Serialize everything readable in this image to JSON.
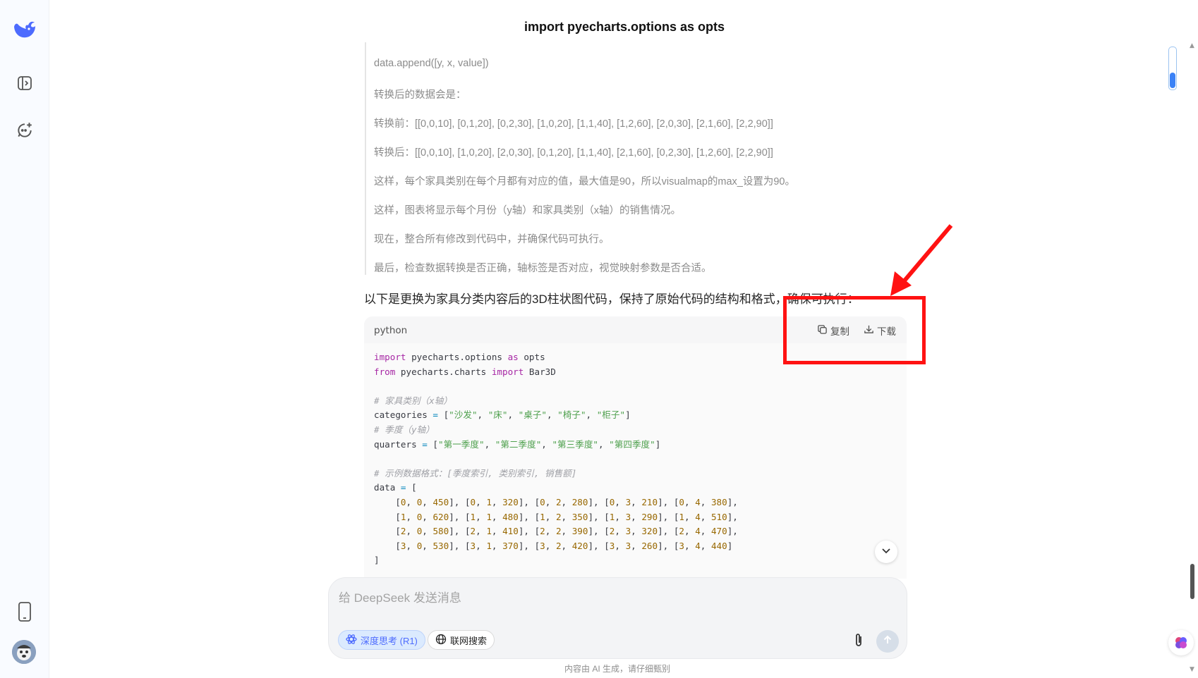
{
  "page": {
    "title": "import pyecharts.options as opts"
  },
  "reasoning": [
    "data.append([y, x, value])",
    "转换后的数据会是：",
    "转换前：[[0,0,10], [0,1,20], [0,2,30], [1,0,20], [1,1,40], [1,2,60], [2,0,30], [2,1,60], [2,2,90]]",
    "转换后：[[0,0,10], [1,0,20], [2,0,30], [0,1,20], [1,1,40], [2,1,60], [0,2,30], [1,2,60], [2,2,90]]",
    "这样，每个家具类别在每个月都有对应的值，最大值是90，所以visualmap的max_设置为90。",
    "这样，图表将显示每个月份（y轴）和家具类别（x轴）的销售情况。",
    "现在，整合所有修改到代码中，并确保代码可执行。",
    "最后，检查数据转换是否正确，轴标签是否对应，视觉映射参数是否合适。"
  ],
  "answer": {
    "lead": "以下是更换为家具分类内容后的3D柱状图代码，保持了原始代码的结构和格式，确保可执行："
  },
  "code": {
    "language": "python",
    "copy_label": "复制",
    "download_label": "下载",
    "lines": [
      "import pyecharts.options as opts",
      "from pyecharts.charts import Bar3D",
      "",
      "# 家具类别（x轴）",
      "categories = [\"沙发\", \"床\", \"桌子\", \"椅子\", \"柜子\"]",
      "# 季度（y轴）",
      "quarters = [\"第一季度\", \"第二季度\", \"第三季度\", \"第四季度\"]",
      "",
      "# 示例数据格式：[季度索引, 类别索引, 销售额]",
      "data = [",
      "    [0, 0, 450], [0, 1, 320], [0, 2, 280], [0, 3, 210], [0, 4, 380],",
      "    [1, 0, 620], [1, 1, 480], [1, 2, 350], [1, 3, 290], [1, 4, 510],",
      "    [2, 0, 580], [2, 1, 410], [2, 2, 390], [2, 3, 320], [2, 4, 470],",
      "    [3, 0, 530], [3, 1, 370], [3, 2, 420], [3, 3, 260], [3, 4, 440]",
      "]"
    ]
  },
  "composer": {
    "placeholder": "给 DeepSeek 发送消息",
    "deep_think_label": "深度思考 (R1)",
    "web_search_label": "联网搜索"
  },
  "footer": {
    "disclaimer": "内容由 AI 生成，请仔细甄别"
  },
  "icons": {
    "logo": "deepseek-whale-icon",
    "sidebar_toggle": "sidebar-toggle-icon",
    "new_chat": "new-chat-icon",
    "phone": "mobile-app-icon",
    "copy": "copy-icon",
    "download": "download-icon",
    "expand": "chevron-down-icon",
    "attach": "paperclip-icon",
    "send": "arrow-up-icon",
    "deep_think": "atom-icon",
    "web_search": "globe-icon",
    "brain": "brain-icon"
  },
  "colors": {
    "accent": "#4d6bfe",
    "annotation": "#ff1212"
  }
}
